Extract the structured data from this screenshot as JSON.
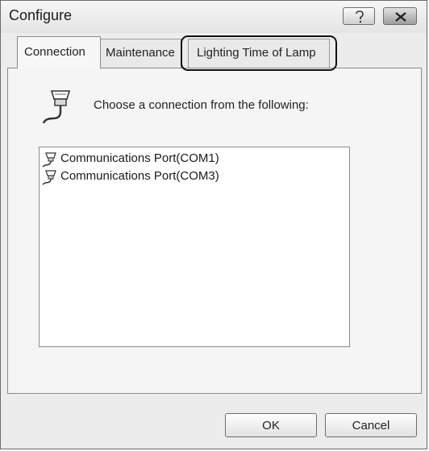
{
  "window": {
    "title": "Configure",
    "help_icon": "help-question-icon",
    "close_icon": "close-x-icon"
  },
  "tabs": [
    {
      "label": "Connection",
      "selected": true
    },
    {
      "label": "Maintenance",
      "selected": false
    },
    {
      "label": "Lighting Time of Lamp",
      "selected": false,
      "highlighted": true
    }
  ],
  "connection_panel": {
    "icon": "serial-connector-icon",
    "prompt": "Choose a connection from the following:",
    "ports": [
      {
        "label": "Communications Port(COM1)",
        "icon": "port-connector-icon"
      },
      {
        "label": "Communications Port(COM3)",
        "icon": "port-connector-icon"
      }
    ]
  },
  "buttons": {
    "ok": "OK",
    "cancel": "Cancel"
  },
  "colors": {
    "window_bg": "#ececec",
    "panel_bg": "#f5f5f5",
    "highlight_ring": "#111111"
  }
}
